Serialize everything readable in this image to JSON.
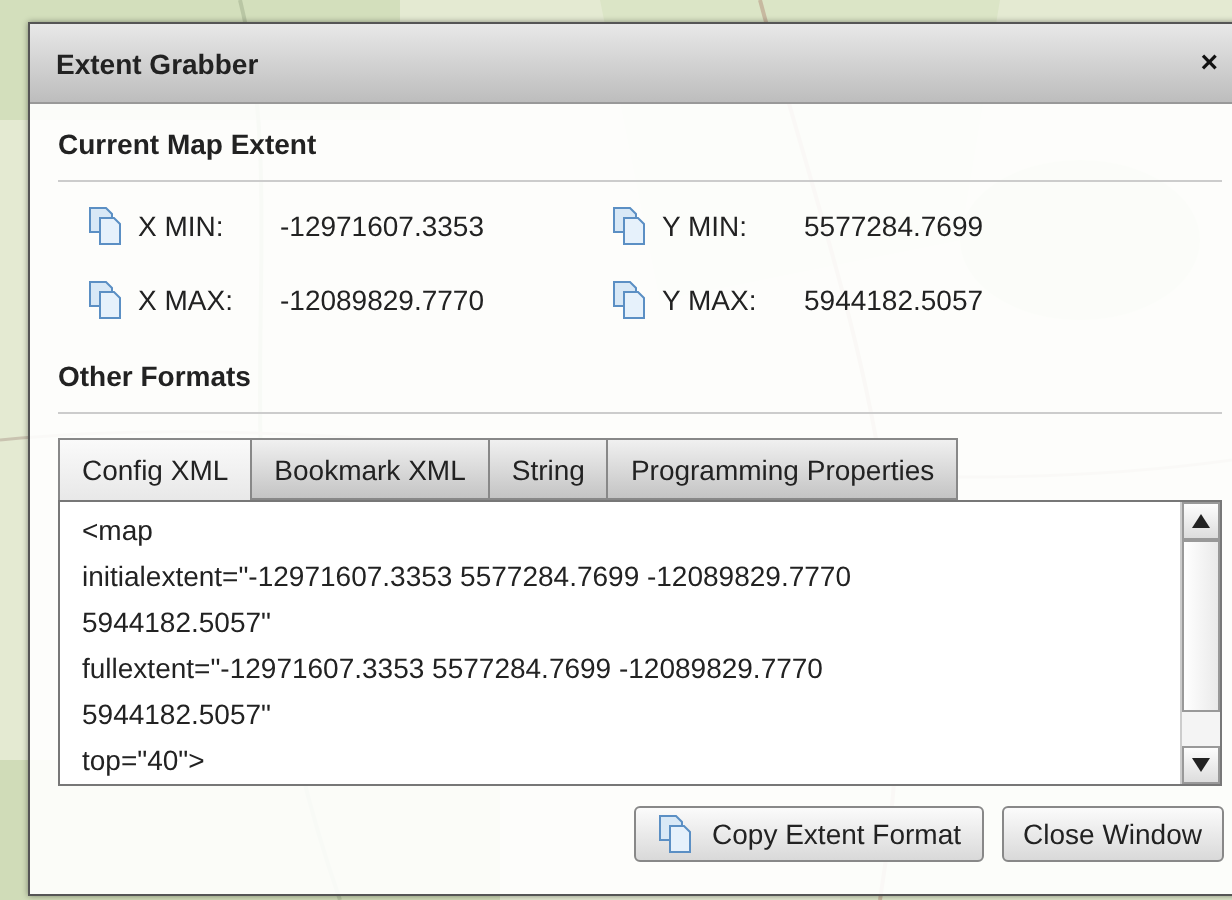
{
  "window": {
    "title": "Extent Grabber",
    "close": "×"
  },
  "current_extent": {
    "heading": "Current Map Extent",
    "fields": [
      {
        "label": "X MIN:",
        "value": "-12971607.3353"
      },
      {
        "label": "Y MIN:",
        "value": "5577284.7699"
      },
      {
        "label": "X MAX:",
        "value": "-12089829.7770"
      },
      {
        "label": "Y MAX:",
        "value": "5944182.5057"
      }
    ]
  },
  "other_formats": {
    "heading": "Other Formats",
    "tabs": [
      {
        "label": "Config XML",
        "selected": true
      },
      {
        "label": "Bookmark XML",
        "selected": false
      },
      {
        "label": "String",
        "selected": false
      },
      {
        "label": "Programming Properties",
        "selected": false
      }
    ],
    "text": "<map\ninitialextent=\"-12971607.3353 5577284.7699 -12089829.7770\n5944182.5057\"\nfullextent=\"-12971607.3353 5577284.7699 -12089829.7770\n5944182.5057\"\ntop=\"40\">"
  },
  "buttons": [
    {
      "label": "Copy Extent Format",
      "kind": "copy"
    },
    {
      "label": "Close Window",
      "kind": "plain"
    }
  ]
}
